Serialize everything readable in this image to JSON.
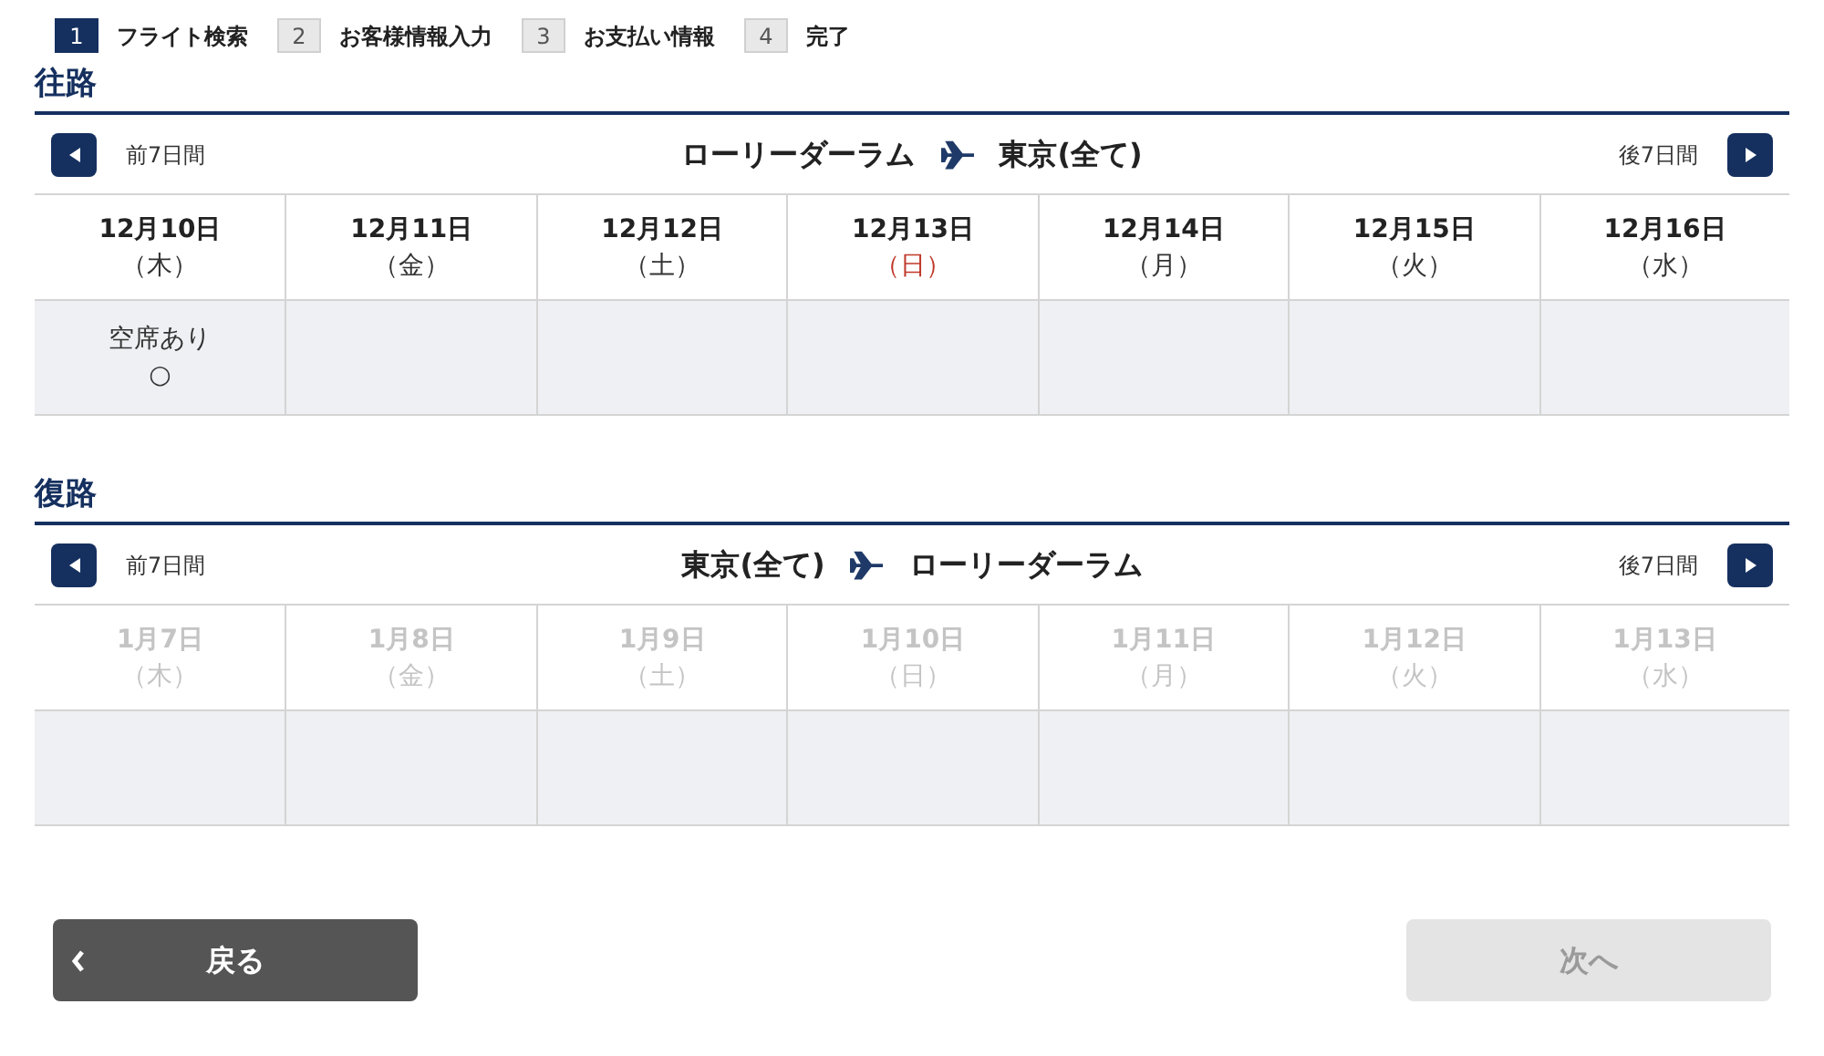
{
  "steps": [
    {
      "number": "1",
      "label": "フライト検索",
      "selected": true
    },
    {
      "number": "2",
      "label": "お客様情報入力",
      "selected": false
    },
    {
      "number": "3",
      "label": "お支払い情報",
      "selected": false
    },
    {
      "number": "4",
      "label": "完了",
      "selected": false
    }
  ],
  "sections": [
    {
      "title": "往路",
      "prev_label": "前7日間",
      "next_label": "後7日間",
      "origin": "ローリーダーラム",
      "destination": "東京(全て)",
      "disabled": false,
      "days": [
        {
          "date": "12月10日",
          "weekday": "（木）",
          "sunday": false,
          "status": "空席あり",
          "mark": "○"
        },
        {
          "date": "12月11日",
          "weekday": "（金）",
          "sunday": false
        },
        {
          "date": "12月12日",
          "weekday": "（土）",
          "sunday": false
        },
        {
          "date": "12月13日",
          "weekday": "（日）",
          "sunday": true
        },
        {
          "date": "12月14日",
          "weekday": "（月）",
          "sunday": false
        },
        {
          "date": "12月15日",
          "weekday": "（火）",
          "sunday": false
        },
        {
          "date": "12月16日",
          "weekday": "（水）",
          "sunday": false
        }
      ]
    },
    {
      "title": "復路",
      "prev_label": "前7日間",
      "next_label": "後7日間",
      "origin": "東京(全て)",
      "destination": "ローリーダーラム",
      "disabled": true,
      "days": [
        {
          "date": "1月7日",
          "weekday": "（木）"
        },
        {
          "date": "1月8日",
          "weekday": "（金）"
        },
        {
          "date": "1月9日",
          "weekday": "（土）"
        },
        {
          "date": "1月10日",
          "weekday": "（日）"
        },
        {
          "date": "1月11日",
          "weekday": "（月）"
        },
        {
          "date": "1月12日",
          "weekday": "（火）"
        },
        {
          "date": "1月13日",
          "weekday": "（水）"
        }
      ]
    }
  ],
  "back_button": {
    "label": "戻る"
  },
  "next_button": {
    "label": "次へ",
    "disabled": true
  }
}
